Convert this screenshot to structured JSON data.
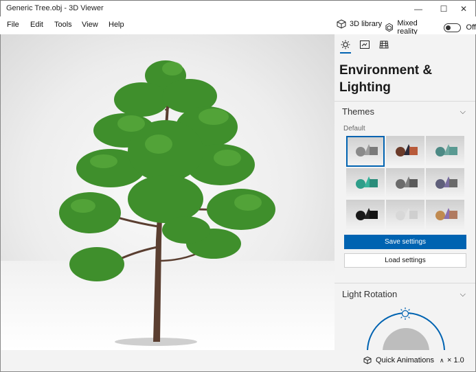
{
  "window": {
    "title": "Generic Tree.obj - 3D Viewer",
    "controls": {
      "minimize": "—",
      "maximize": "☐",
      "close": "✕"
    }
  },
  "menu": {
    "items": [
      "File",
      "Edit",
      "Tools",
      "View",
      "Help"
    ],
    "library_label": "3D library",
    "mixed_reality_label": "Mixed reality",
    "mixed_reality_state": "Off"
  },
  "panel": {
    "tabs": [
      "sun-icon",
      "image-icon",
      "grid-icon"
    ],
    "title": "Environment & Lighting",
    "themes": {
      "heading": "Themes",
      "sub_heading": "Default",
      "save_label": "Save settings",
      "load_label": "Load settings"
    },
    "light_rotation": {
      "heading": "Light Rotation"
    }
  },
  "status": {
    "quick_animations": "Quick Animations",
    "speed": "× 1.0"
  },
  "colors": {
    "accent": "#0063b1",
    "leaf": "#3f8f2c",
    "trunk": "#5a3e30"
  }
}
